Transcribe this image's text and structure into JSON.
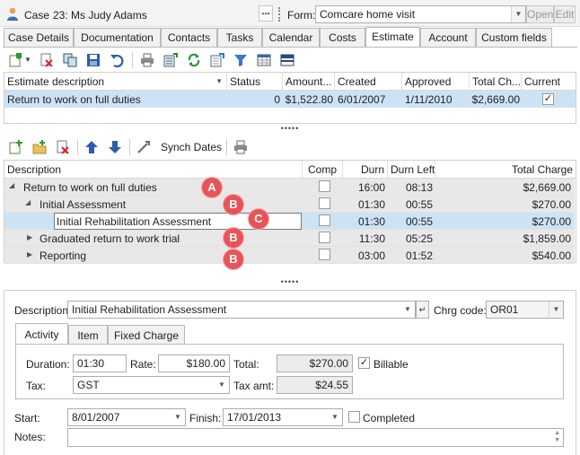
{
  "title_bar": {
    "case_label": "Case",
    "case_value": "23: Ms Judy Adams",
    "more_label": "...",
    "form_label": "Form:",
    "form_value": "Comcare home visit",
    "open_label": "Open",
    "edit_label": "Edit"
  },
  "tabs": [
    "Case Details",
    "Documentation",
    "Contacts",
    "Tasks",
    "Calendar",
    "Costs",
    "Estimate",
    "Account",
    "Custom fields"
  ],
  "active_tab": "Estimate",
  "estimate_grid": {
    "headers": [
      "Estimate description",
      "Status",
      "Amount...",
      "Created",
      "Approved",
      "Total Ch...",
      "Current"
    ],
    "row": {
      "description": "Return to work on full duties",
      "status": "0",
      "amount": "$1,522.80",
      "created": "6/01/2007",
      "approved": "1/11/2010",
      "total_charge": "$2,669.00",
      "current": true
    }
  },
  "splitter_dots": "•••••",
  "tree_toolbar": {
    "synch_label": "Synch Dates"
  },
  "tree_grid": {
    "headers": [
      "Description",
      "Comp",
      "Durn",
      "Durn Left",
      "Total Charge"
    ],
    "rows": [
      {
        "description": "Return to work on full duties",
        "durn": "16:00",
        "durn_left": "08:13",
        "total": "$2,669.00",
        "marker": "A"
      },
      {
        "description": "Initial Assessment",
        "durn": "01:30",
        "durn_left": "00:55",
        "total": "$270.00",
        "marker": "B"
      },
      {
        "description": "Initial Rehabilitation Assessment",
        "durn": "01:30",
        "durn_left": "00:55",
        "total": "$270.00",
        "marker": "C"
      },
      {
        "description": "Graduated return to work trial",
        "durn": "11:30",
        "durn_left": "05:25",
        "total": "$1,859.00",
        "marker": "B"
      },
      {
        "description": "Reporting",
        "durn": "03:00",
        "durn_left": "01:52",
        "total": "$540.00",
        "marker": "B"
      }
    ]
  },
  "detail": {
    "description_label": "Description",
    "description_value": "Initial Rehabilitation Assessment",
    "chrg_code_label": "Chrg code:",
    "chrg_code_value": "OR01",
    "subtabs": [
      "Activity",
      "Item",
      "Fixed Charge"
    ],
    "duration_label": "Duration:",
    "duration_value": "01:30",
    "rate_label": "Rate:",
    "rate_value": "$180.00",
    "total_label": "Total:",
    "total_value": "$270.00",
    "billable_label": "Billable",
    "billable": true,
    "tax_label": "Tax:",
    "tax_value": "GST",
    "tax_amt_label": "Tax amt:",
    "tax_amt_value": "$24.55",
    "start_label": "Start:",
    "start_value": "8/01/2007",
    "finish_label": "Finish:",
    "finish_value": "17/01/2013",
    "completed_label": "Completed",
    "notes_label": "Notes:"
  }
}
